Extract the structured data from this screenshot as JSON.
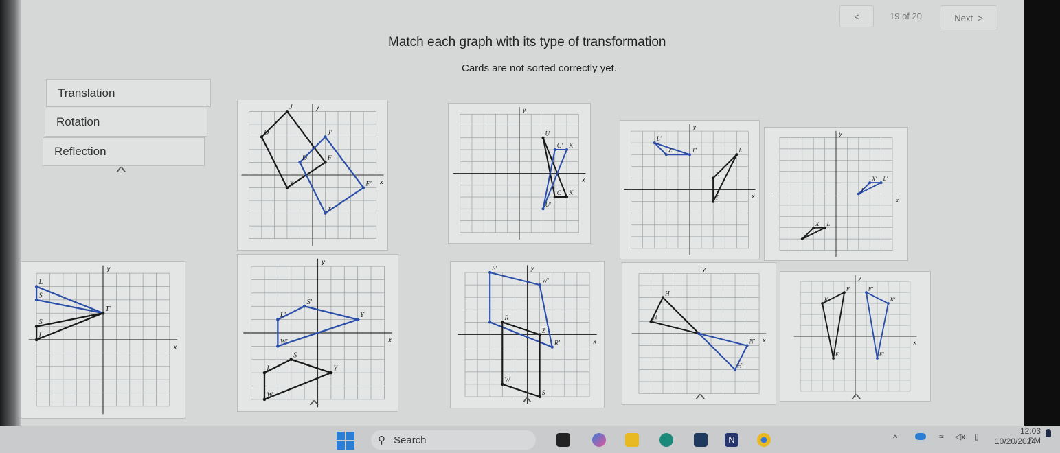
{
  "nav": {
    "prev_icon": "chevron-left-icon",
    "prev_label": "<",
    "counter": "19 of 20",
    "next_label": "Next",
    "next_icon": "chevron-right-icon"
  },
  "prompt": {
    "title": "Match each graph with its type of transformation",
    "status": "Cards are not sorted correctly yet."
  },
  "categories": [
    {
      "label": "Translation"
    },
    {
      "label": "Rotation"
    },
    {
      "label": "Reflection"
    }
  ],
  "collapse_icon": "caret-up-icon",
  "colors": {
    "original": "#1a1a1a",
    "image": "#2b4fa8",
    "grid": "#9ea3a6"
  },
  "cards": [
    {
      "shapes": [
        {
          "color": "original",
          "pts": [
            [
              -4,
              3
            ],
            [
              -2,
              5
            ],
            [
              1,
              1
            ],
            [
              -2,
              -1
            ]
          ],
          "labels": [
            "D",
            "J",
            "F",
            "X"
          ]
        },
        {
          "color": "image",
          "pts": [
            [
              -1,
              1
            ],
            [
              1,
              3
            ],
            [
              4,
              -1
            ],
            [
              1,
              -3
            ]
          ],
          "labels": [
            "D'",
            "J'",
            "F'",
            "X'"
          ]
        }
      ]
    },
    {
      "shapes": [
        {
          "color": "original",
          "pts": [
            [
              2,
              3
            ],
            [
              4,
              -2
            ],
            [
              3,
              -2
            ]
          ],
          "labels": [
            "U",
            "K",
            "C"
          ]
        },
        {
          "color": "image",
          "pts": [
            [
              2,
              -3
            ],
            [
              4,
              2
            ],
            [
              3,
              2
            ]
          ],
          "labels": [
            "U'",
            "K'",
            "C'"
          ]
        }
      ]
    },
    {
      "shapes": [
        {
          "color": "image",
          "pts": [
            [
              -3,
              4
            ],
            [
              -2,
              3
            ],
            [
              0,
              3
            ]
          ],
          "labels": [
            "L'",
            "Z'",
            "T'"
          ]
        },
        {
          "color": "original",
          "pts": [
            [
              4,
              3
            ],
            [
              2,
              1
            ],
            [
              2,
              -1
            ]
          ],
          "labels": [
            "L",
            "Z",
            "T"
          ]
        }
      ]
    },
    {
      "shapes": [
        {
          "color": "image",
          "pts": [
            [
              3,
              1
            ],
            [
              4,
              1
            ],
            [
              2,
              0
            ]
          ],
          "labels": [
            "X'",
            "L'",
            "J'"
          ]
        },
        {
          "color": "original",
          "pts": [
            [
              -2,
              -3
            ],
            [
              -1,
              -3
            ],
            [
              -3,
              -4
            ]
          ],
          "labels": [
            "X",
            "L",
            "J"
          ]
        }
      ]
    },
    {
      "shapes": [
        {
          "color": "image",
          "pts": [
            [
              -5,
              4
            ],
            [
              -5,
              3
            ],
            [
              0,
              2
            ]
          ],
          "labels": [
            "L",
            "S",
            "T'"
          ]
        },
        {
          "color": "original",
          "pts": [
            [
              -5,
              1
            ],
            [
              -5,
              0
            ],
            [
              0,
              2
            ]
          ],
          "labels": [
            "S",
            "L",
            ""
          ]
        }
      ]
    },
    {
      "shapes": [
        {
          "color": "image",
          "pts": [
            [
              -1,
              2
            ],
            [
              3,
              1
            ],
            [
              -3,
              -1
            ],
            [
              -3,
              1
            ]
          ],
          "labels": [
            "S'",
            "Y'",
            "W'",
            "L'"
          ]
        },
        {
          "color": "original",
          "pts": [
            [
              -2,
              -2
            ],
            [
              1,
              -3
            ],
            [
              -4,
              -5
            ],
            [
              -4,
              -3
            ]
          ],
          "labels": [
            "S",
            "Y",
            "W",
            "L"
          ]
        }
      ]
    },
    {
      "shapes": [
        {
          "color": "image",
          "pts": [
            [
              -3,
              5
            ],
            [
              1,
              4
            ],
            [
              2,
              -1
            ],
            [
              -3,
              1
            ]
          ],
          "labels": [
            "S'",
            "W'",
            "R'",
            ""
          ]
        },
        {
          "color": "original",
          "pts": [
            [
              -2,
              1
            ],
            [
              1,
              0
            ],
            [
              1,
              -5
            ],
            [
              -2,
              -4
            ]
          ],
          "labels": [
            "R",
            "Z",
            "S",
            "W"
          ]
        }
      ]
    },
    {
      "shapes": [
        {
          "color": "original",
          "pts": [
            [
              -3,
              3
            ],
            [
              -4,
              1
            ],
            [
              0,
              0
            ]
          ],
          "labels": [
            "H",
            "N",
            ""
          ]
        },
        {
          "color": "image",
          "pts": [
            [
              0,
              0
            ],
            [
              4,
              -1
            ],
            [
              3,
              -3
            ]
          ],
          "labels": [
            "",
            "N'",
            "H'"
          ]
        }
      ]
    },
    {
      "shapes": [
        {
          "color": "original",
          "pts": [
            [
              -3,
              3
            ],
            [
              -1,
              4
            ],
            [
              -2,
              -2
            ]
          ],
          "labels": [
            "K",
            "F",
            "E"
          ]
        },
        {
          "color": "image",
          "pts": [
            [
              3,
              3
            ],
            [
              1,
              4
            ],
            [
              2,
              -2
            ]
          ],
          "labels": [
            "K'",
            "F'",
            "E'"
          ]
        }
      ]
    }
  ],
  "axis_labels": {
    "x": "x",
    "y": "y"
  },
  "taskbar": {
    "start_icon": "windows-start-icon",
    "search_placeholder": "Search",
    "apps": [
      "task-view-icon",
      "copilot-icon",
      "file-explorer-icon",
      "edge-icon",
      "store-icon",
      "onenote-icon",
      "chrome-icon"
    ],
    "time": "12:03 PM",
    "date": "10/20/2024"
  }
}
